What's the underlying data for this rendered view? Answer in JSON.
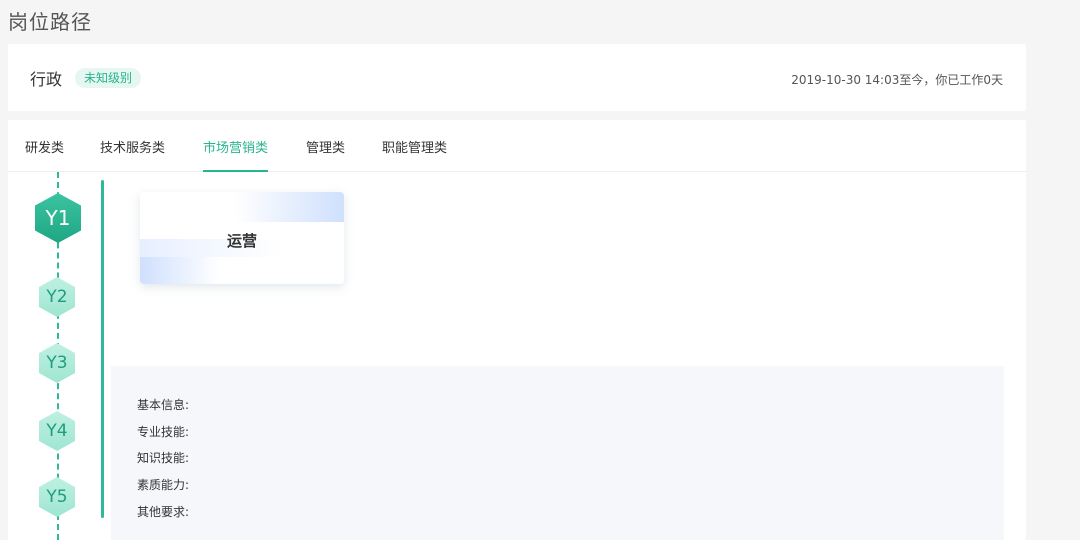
{
  "page": {
    "title": "岗位路径"
  },
  "header": {
    "job_name": "行政",
    "level_badge": "未知级别",
    "work_info": "2019-10-30 14:03至今，你已工作0天"
  },
  "tabs": [
    {
      "label": "研发类",
      "active": false
    },
    {
      "label": "技术服务类",
      "active": false
    },
    {
      "label": "市场营销类",
      "active": true
    },
    {
      "label": "管理类",
      "active": false
    },
    {
      "label": "职能管理类",
      "active": false
    }
  ],
  "timeline": {
    "levels": [
      "Y1",
      "Y2",
      "Y3",
      "Y4",
      "Y5"
    ],
    "current": "Y1"
  },
  "job_card": {
    "label": "运营"
  },
  "info": {
    "basic": "基本信息:",
    "skills": "专业技能:",
    "knowledge": "知识技能:",
    "quality": "素质能力:",
    "other": "其他要求:"
  },
  "colors": {
    "accent": "#27b48f",
    "badge_bg": "#e6f7f1",
    "panel_bg": "#f5f7fa"
  }
}
